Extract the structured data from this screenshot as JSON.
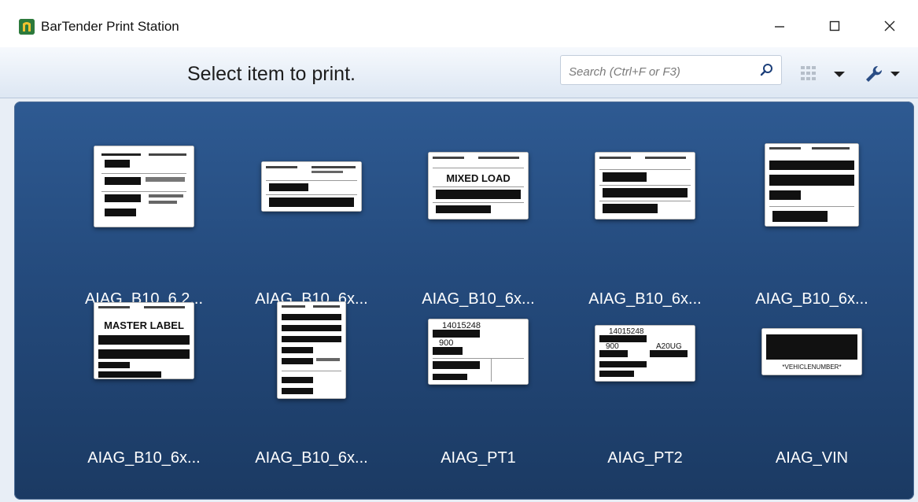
{
  "window": {
    "title": "BarTender Print Station",
    "controls": {
      "minimize": "—",
      "maximize": "☐",
      "close": "✕"
    }
  },
  "toolbar": {
    "headline": "Select item to print.",
    "search_placeholder": "Search (Ctrl+F or F3)",
    "view_menu_icon": "grid-view-icon",
    "tools_menu_icon": "wrench-icon"
  },
  "items": [
    {
      "label": "AIAG_B10_6.2...",
      "thumb_text": ""
    },
    {
      "label": "AIAG_B10_6x...",
      "thumb_text": ""
    },
    {
      "label": "AIAG_B10_6x...",
      "thumb_text": "MIXED LOAD"
    },
    {
      "label": "AIAG_B10_6x...",
      "thumb_text": ""
    },
    {
      "label": "AIAG_B10_6x...",
      "thumb_text": ""
    },
    {
      "label": "AIAG_B10_6x...",
      "thumb_text": "MASTER LABEL"
    },
    {
      "label": "AIAG_B10_6x...",
      "thumb_text": ""
    },
    {
      "label": "AIAG_PT1",
      "thumb_text": "14015248",
      "thumb_text2": "900"
    },
    {
      "label": "AIAG_PT2",
      "thumb_text": "14015248",
      "thumb_text2": "900",
      "thumb_text3": "A20UG"
    },
    {
      "label": "AIAG_VIN",
      "thumb_text": "*VEHICLENUMBER*"
    }
  ],
  "colors": {
    "gallery_top": "#2e5a92",
    "gallery_bottom": "#1b3a63",
    "app_icon": "#2d7a3c"
  }
}
